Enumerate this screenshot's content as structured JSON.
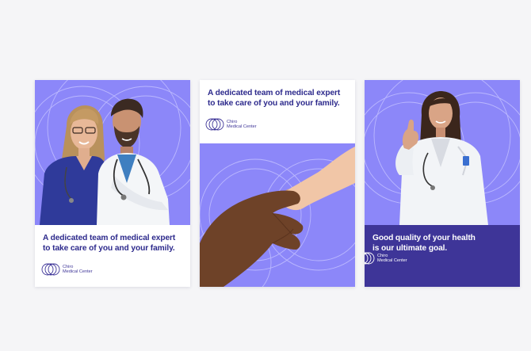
{
  "colors": {
    "violet": "#8c87f9",
    "navy": "#3e3598",
    "ink": "#2d2a8c",
    "white": "#ffffff",
    "page_bg": "#f5f5f7"
  },
  "cards": [
    {
      "headline_line1": "A dedicated team of medical expert",
      "headline_line2": "to take care of you and your family.",
      "logo_line1": "Chiro",
      "logo_line2": "Medical Center",
      "photo": "two-doctors-photo"
    },
    {
      "headline_line1": "A dedicated team of medical expert",
      "headline_line2": "to take care of you and your family.",
      "logo_line1": "Chiro",
      "logo_line2": "Medical Center",
      "photo": "handshake-photo"
    },
    {
      "headline_line1": "Good quality of your health",
      "headline_line2": "is our ultimate goal.",
      "logo_line1": "Chiro",
      "logo_line2": "Medical Center",
      "photo": "doctor-thumbs-up-photo"
    }
  ]
}
